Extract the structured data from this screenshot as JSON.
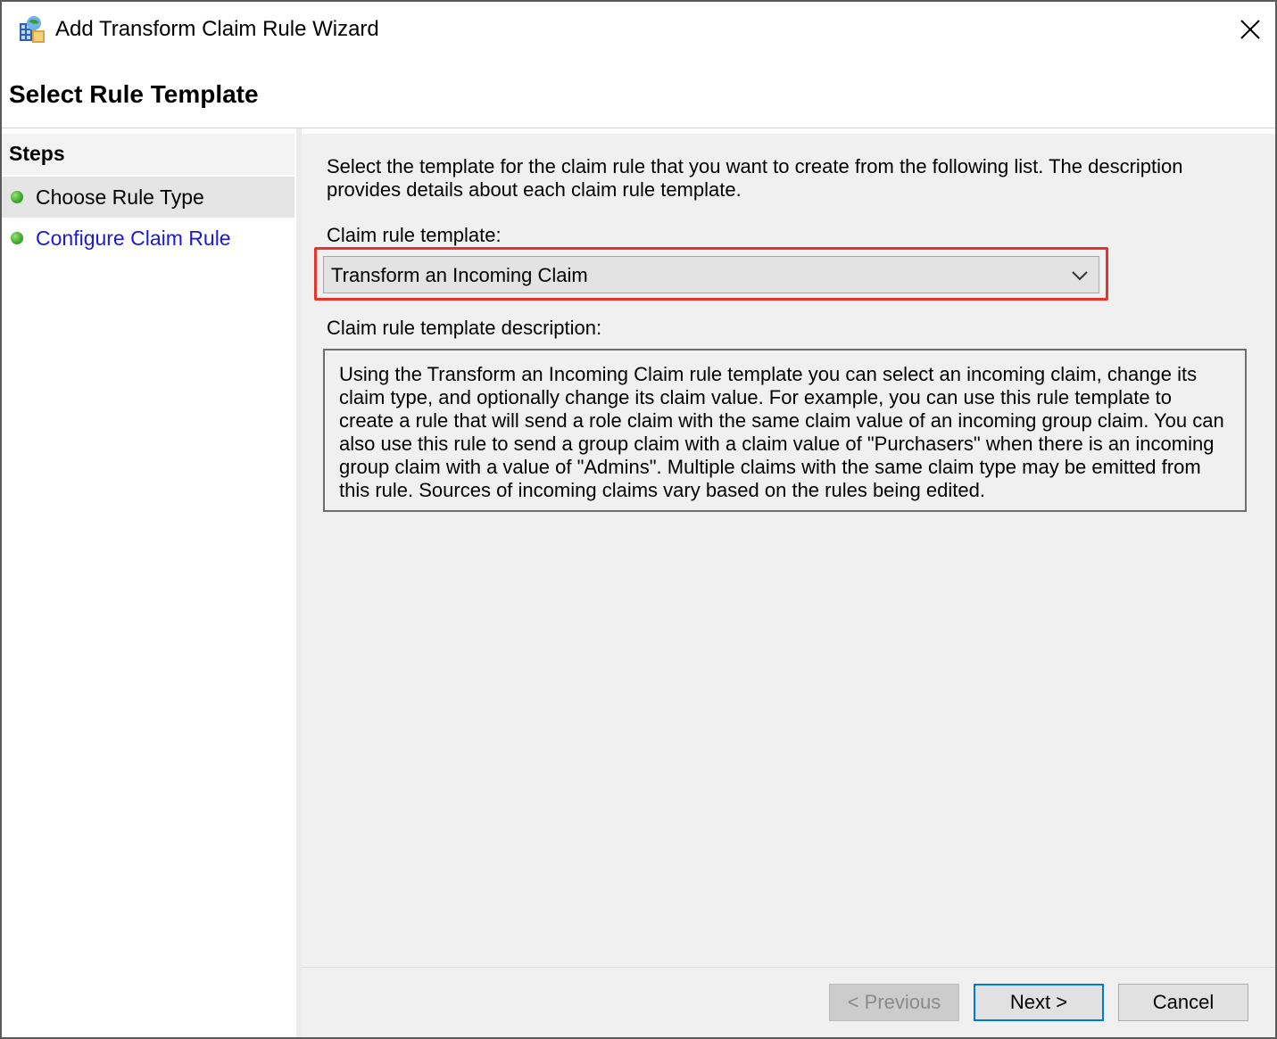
{
  "window": {
    "title": "Add Transform Claim Rule Wizard",
    "close_icon": "close-icon",
    "app_icon": "adfs-wizard-icon"
  },
  "header": {
    "page_title": "Select Rule Template"
  },
  "steps": {
    "heading": "Steps",
    "items": [
      {
        "label": "Choose Rule Type",
        "state": "current",
        "color": "#000000"
      },
      {
        "label": "Configure Claim Rule",
        "state": "upcoming",
        "color": "#1a1ad6"
      }
    ],
    "dot_color": "#3fae2a"
  },
  "main": {
    "instructions": "Select the template for the claim rule that you want to create from the following list. The description provides details about each claim rule template.",
    "template_label": "Claim rule template:",
    "template_value": "Transform an Incoming Claim",
    "description_label": "Claim rule template description:",
    "description_text": "Using the Transform an Incoming Claim rule template you can select an incoming claim, change its claim type, and optionally change its claim value.  For example, you can use this rule template to create a rule that will send a role claim with the same claim value of an incoming group claim.  You can also use this rule to send a group claim with a claim value of \"Purchasers\" when there is an incoming group claim with a value of \"Admins\".  Multiple claims with the same claim type may be emitted from this rule.  Sources of incoming claims vary based on the rules being edited.",
    "highlight_color": "#e8332a"
  },
  "footer": {
    "previous_label": "< Previous",
    "next_label": "Next >",
    "cancel_label": "Cancel",
    "accent_color": "#0078d7"
  }
}
